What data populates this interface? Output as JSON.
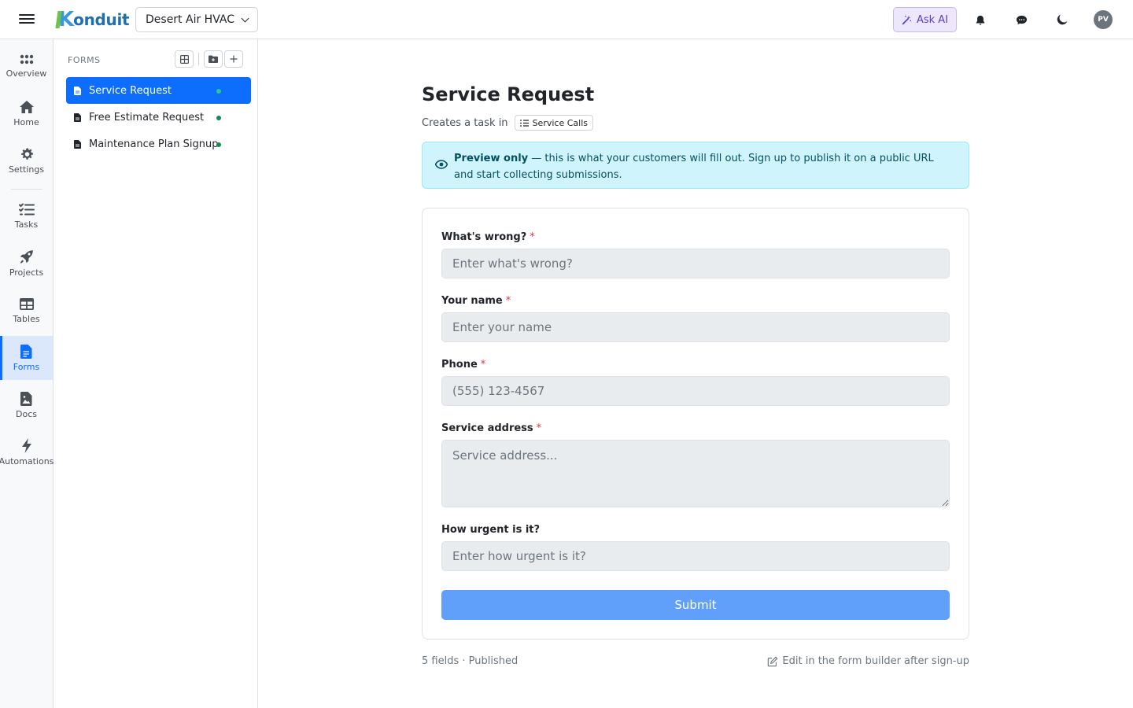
{
  "topbar": {
    "logo_mark": "K",
    "logo_text": "onduit",
    "workspace": "Desert Air HVAC",
    "ask_ai": "Ask AI",
    "avatar_initials": "PV"
  },
  "rail": {
    "items": [
      {
        "label": "Overview",
        "icon": "grid-icon"
      },
      {
        "label": "Home",
        "icon": "home-icon"
      },
      {
        "label": "Settings",
        "icon": "gear-icon"
      },
      {
        "label": "Tasks",
        "icon": "checklist-icon"
      },
      {
        "label": "Projects",
        "icon": "rocket-icon"
      },
      {
        "label": "Tables",
        "icon": "table-icon"
      },
      {
        "label": "Forms",
        "icon": "document-icon"
      },
      {
        "label": "Docs",
        "icon": "image-doc-icon"
      },
      {
        "label": "Automations",
        "icon": "lightning-icon"
      }
    ],
    "active": "Forms"
  },
  "forms_panel": {
    "header": "FORMS",
    "items": [
      {
        "label": "Service Request"
      },
      {
        "label": "Free Estimate Request"
      },
      {
        "label": "Maintenance Plan Signup"
      }
    ]
  },
  "main": {
    "title": "Service Request",
    "subtitle_prefix": "Creates a task in",
    "subtitle_chip": "Service Calls",
    "banner_bold": "Preview only",
    "banner_text": " — this is what your customers will fill out. Sign up to publish it on a public URL and start collecting submissions.",
    "fields": [
      {
        "label": "What's wrong?",
        "required": "*",
        "placeholder": "Enter what's wrong?"
      },
      {
        "label": "Your name",
        "required": "*",
        "placeholder": "Enter your name"
      },
      {
        "label": "Phone",
        "required": "*",
        "placeholder": "(555) 123-4567"
      },
      {
        "label": "Service address",
        "required": "*",
        "placeholder": "Service address..."
      },
      {
        "label": "How urgent is it?",
        "required": "",
        "placeholder": "Enter how urgent is it?"
      }
    ],
    "submit": "Submit",
    "footer_left": "5 fields · Published",
    "footer_right": "Edit in the form builder after sign-up"
  },
  "colors": {
    "primary": "#0d6efd",
    "submit": "#60a0fb",
    "banner_bg": "#cff4fc",
    "ask_ai_bg": "#ede7fb",
    "status_dot": "#198754"
  }
}
